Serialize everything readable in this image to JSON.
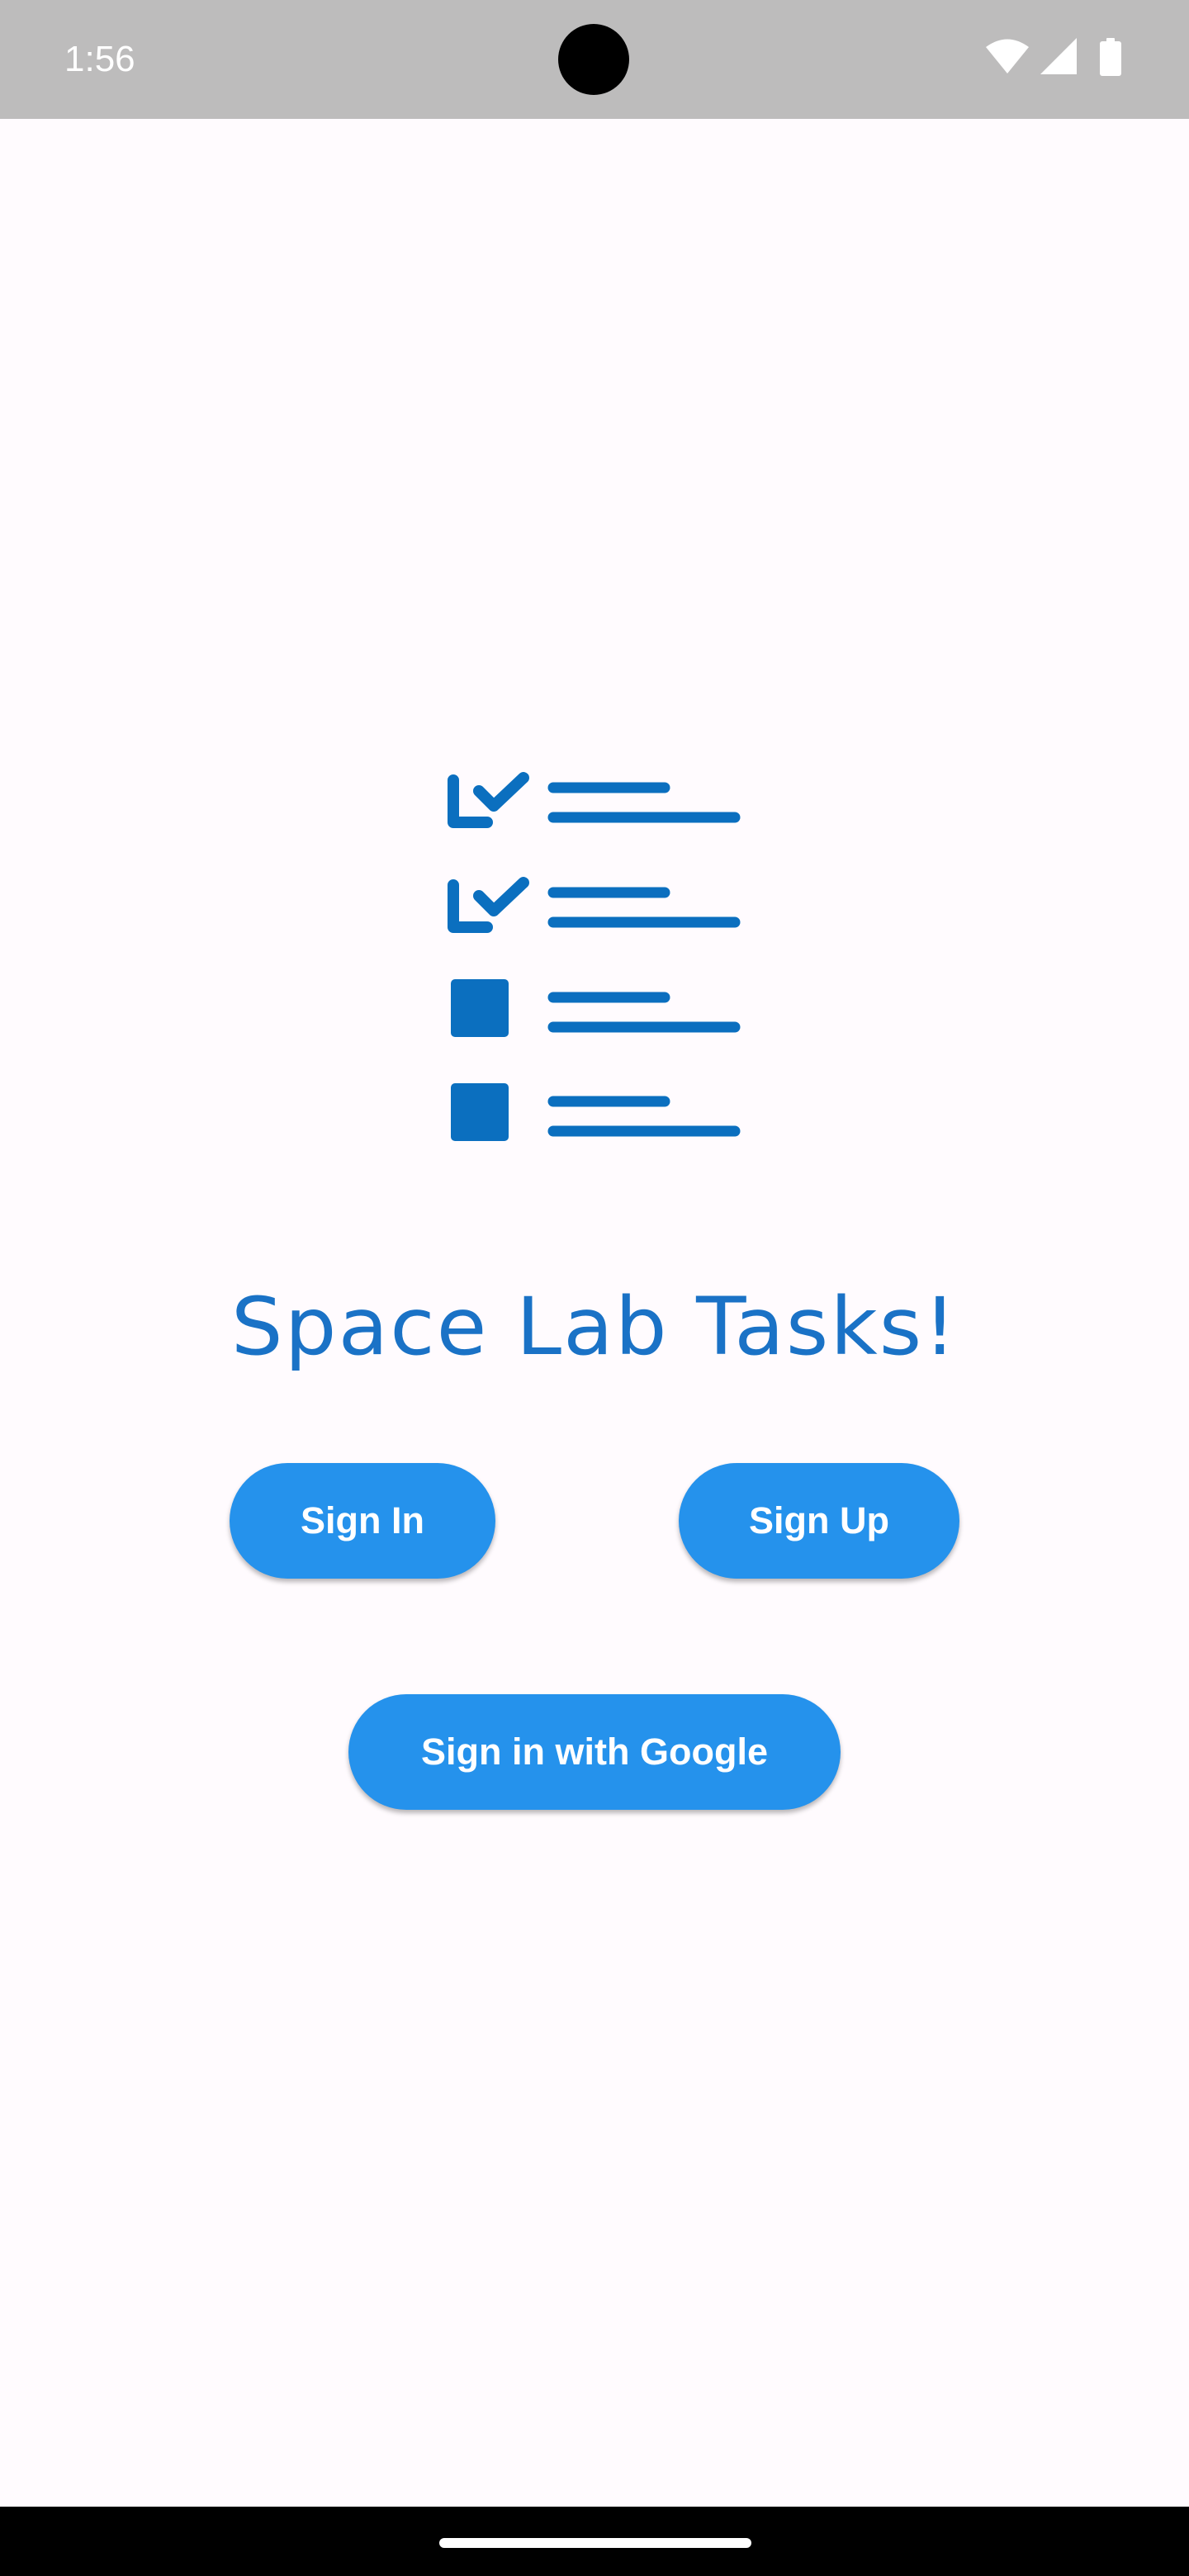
{
  "status_bar": {
    "time": "1:56",
    "icons": [
      "wifi-icon",
      "cell-signal-icon",
      "battery-icon"
    ]
  },
  "app": {
    "logo_icon": "checklist-icon",
    "title": "Space Lab Tasks!"
  },
  "buttons": {
    "sign_in": "Sign In",
    "sign_up": "Sign Up",
    "google": "Sign in with Google"
  },
  "colors": {
    "accent": "#2592ec",
    "title": "#1a72c6",
    "logo": "#0b6fbf",
    "background": "#fffbfe",
    "status_bar": "#bdbcbc"
  }
}
